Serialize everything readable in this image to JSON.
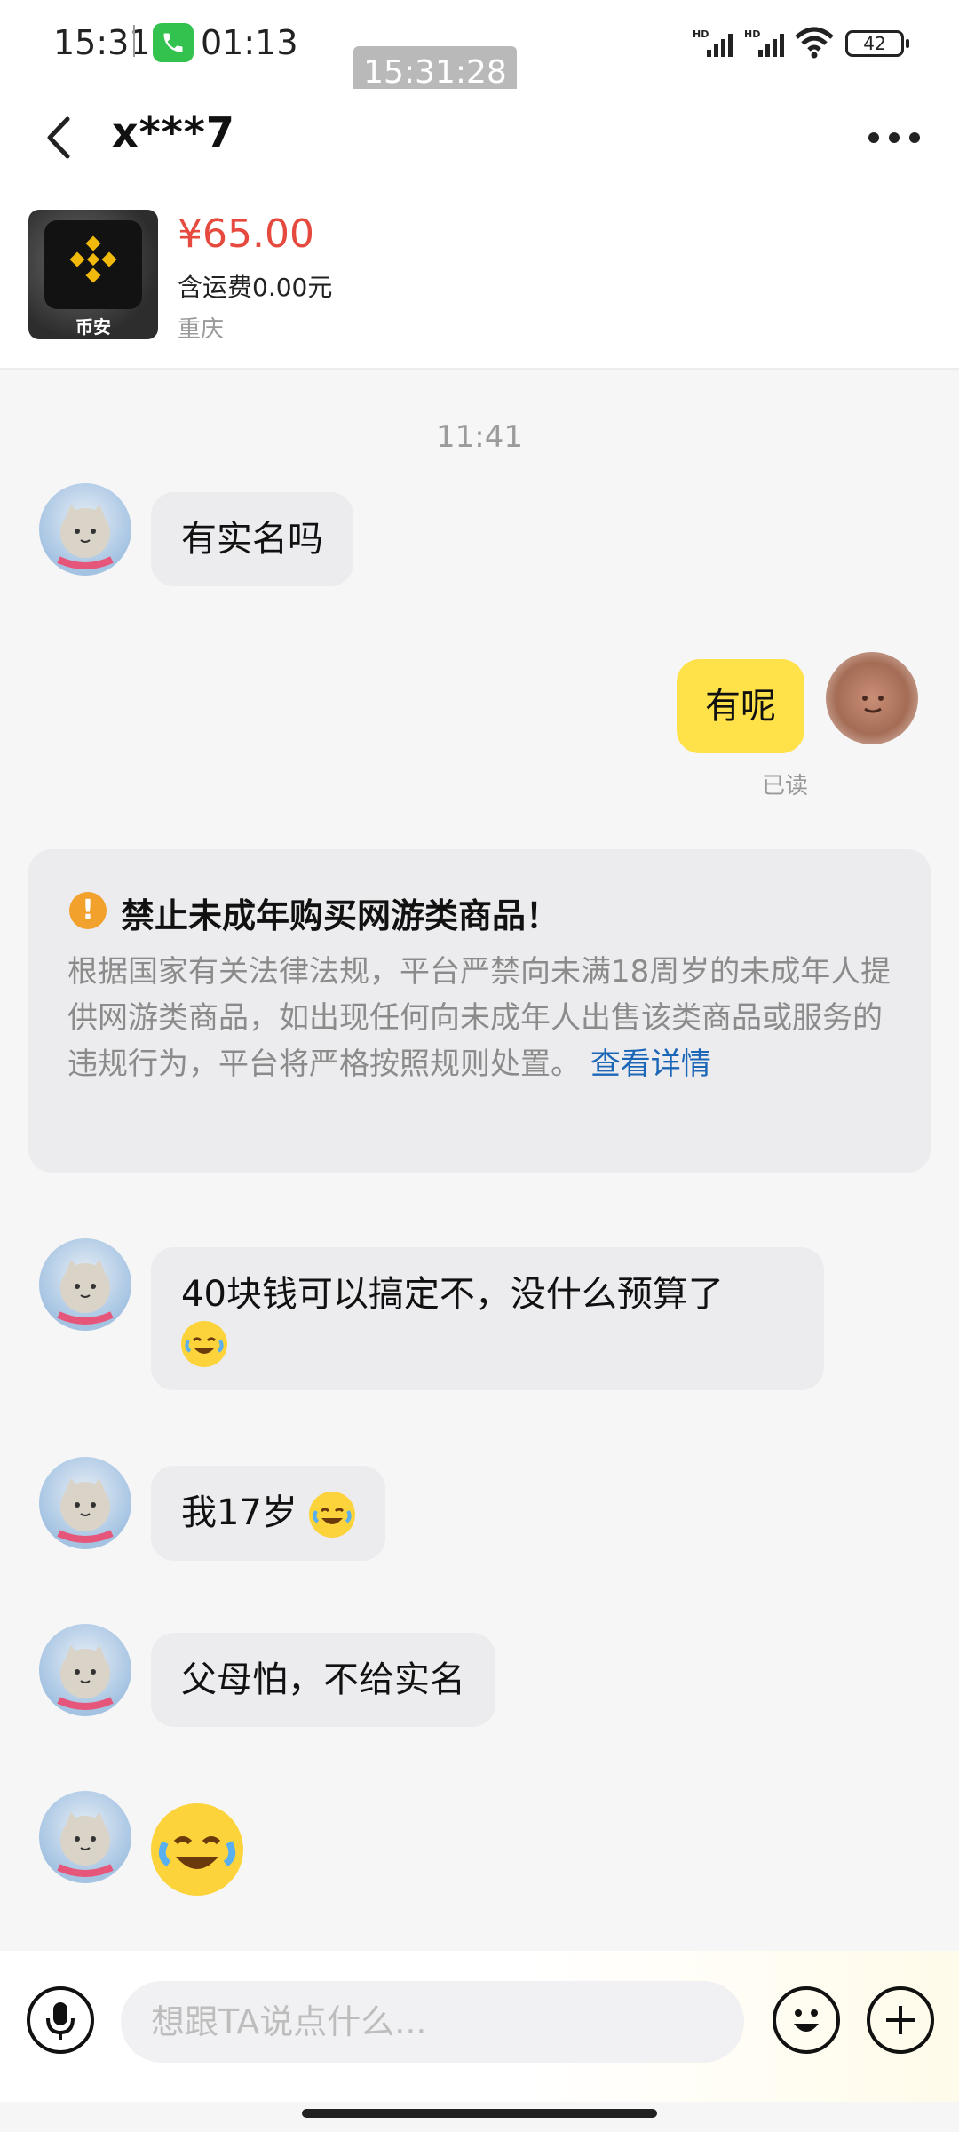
{
  "status_bar": {
    "time": "15:31",
    "call_duration": "01:13",
    "screenshot_time": "15:31:28",
    "battery": "42",
    "icons": [
      "call-icon",
      "hd-signal-icon",
      "hd-signal-icon",
      "wifi-icon",
      "battery-icon"
    ]
  },
  "nav": {
    "title": "x***7",
    "icons": [
      "back-arrow-icon",
      "more-dots-icon"
    ]
  },
  "product": {
    "image_label": "币安",
    "price": "¥65.00",
    "shipping": "含运费0.00元",
    "location": "重庆"
  },
  "chat": {
    "timestamp": "11:41",
    "messages": [
      {
        "from": "other",
        "text": "有实名吗"
      },
      {
        "from": "me",
        "text": "有呢",
        "status": "已读"
      },
      {
        "from": "other",
        "text": "40块钱可以搞定不，没什么预算了"
      },
      {
        "from": "other",
        "text": "我17岁"
      },
      {
        "from": "other",
        "text": "父母怕，不给实名"
      }
    ],
    "emojis": [
      "crying-laughing-emoji",
      "crying-laughing-emoji",
      "crying-laughing-emoji"
    ]
  },
  "warning": {
    "title": "禁止未成年购买网游类商品！",
    "body": "根据国家有关法律法规，平台严禁向未满18周岁的未成年人提供网游类商品，如出现任何向未成年人出售该类商品或服务的违规行为，平台将严格按照规则处置。",
    "link": "查看详情",
    "icon_symbol": "!"
  },
  "input_bar": {
    "placeholder": "想跟TA说点什么...",
    "icons": [
      "microphone-icon",
      "emoji-icon",
      "plus-icon"
    ]
  },
  "colors": {
    "my_bubble": "#ffe14a",
    "other_bubble": "#ececee",
    "price": "#e64a3e",
    "link": "#1c66b8",
    "warning_icon": "#f3a12d"
  }
}
